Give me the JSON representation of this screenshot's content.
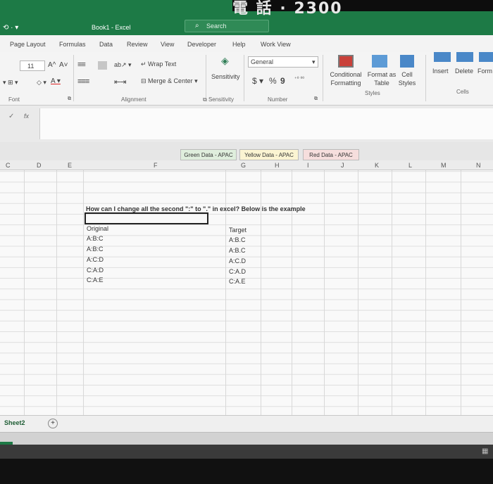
{
  "window": {
    "top_text": "電 話 · 2300",
    "quick_access": "⟲ · ▾",
    "title": "Book1 - Excel",
    "search_placeholder": "Search"
  },
  "ribbon_tabs": [
    "Page Layout",
    "Formulas",
    "Data",
    "Review",
    "View",
    "Developer",
    "Help",
    "Work View"
  ],
  "ribbon": {
    "font_size": "11",
    "grow_font": "A^",
    "shrink_font": "A˅",
    "wrap_text": "Wrap Text",
    "merge_center": "Merge & Center",
    "sensitivity": "Sensitivity",
    "number_format": "General",
    "currency": "$",
    "percent": "%",
    "comma": "9",
    "conditional_formatting": "Conditional Formatting",
    "format_as_table": "Format as Table",
    "cell_styles": "Cell Styles",
    "insert": "Insert",
    "delete": "Delete",
    "format": "Form",
    "groups": {
      "font": "Font",
      "alignment": "Alignment",
      "sensitivity": "Sensitivity",
      "number": "Number",
      "styles": "Styles",
      "cells": "Cells"
    }
  },
  "formula_bar": {
    "check": "✓",
    "fx": "fx",
    "value": ""
  },
  "sheet_header_tabs": [
    "Green Data - APAC",
    "Yellow Data - APAC",
    "Red Data - APAC"
  ],
  "columns": [
    "C",
    "D",
    "E",
    "F",
    "G",
    "H",
    "I",
    "J",
    "K",
    "L",
    "M",
    "N"
  ],
  "content": {
    "question": "How can I change all the second \":\" to \".\" in excel? Below is the example",
    "original_header": "Original",
    "target_header": "Target",
    "original": [
      "A:B:C",
      "A:B:C",
      "A:C:D",
      "C:A:D",
      "C:A:E"
    ],
    "target": [
      "A:B.C",
      "A:B.C",
      "A:C.D",
      "C:A.D",
      "C:A.E"
    ]
  },
  "sheet_tabs": {
    "active": "Sheet2",
    "add": "+"
  },
  "colors": {
    "excel_green": "#1d7a46",
    "green_tab": "#dfeedd",
    "yellow_tab": "#fbf4d2",
    "red_tab": "#f6dedd"
  }
}
